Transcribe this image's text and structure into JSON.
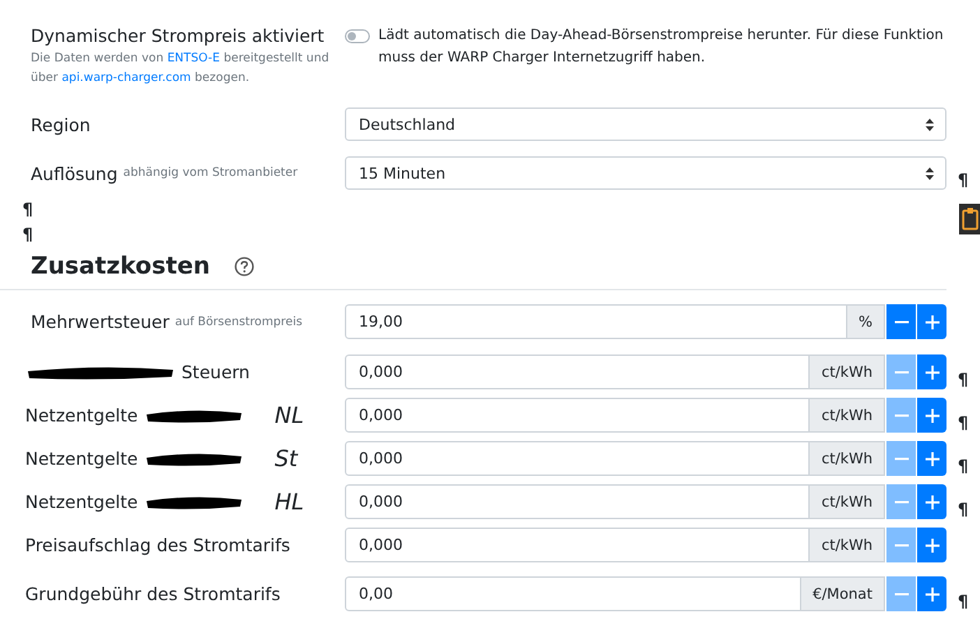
{
  "dynamic_price": {
    "title": "Dynamischer Strompreis aktiviert",
    "description": [
      {
        "text": "Die Daten werden von ",
        "link": false
      },
      {
        "text": "ENTSO-E",
        "link": true
      },
      {
        "text": " bereitgestellt und über ",
        "link": false
      },
      {
        "text": "api.warp-charger.com",
        "link": true
      },
      {
        "text": " bezogen.",
        "link": false
      }
    ],
    "switch_on": false,
    "switch_text": "Lädt automatisch die Day-Ahead-Börsenstrompreise herunter. Für diese Funktion muss der WARP Charger Internetzugriff haben."
  },
  "selects": [
    {
      "label": "Region",
      "value": "Deutschland"
    },
    {
      "label": "Auflösung",
      "hint": "abhängig vom Stromanbieter",
      "value": "15 Minuten",
      "pilcrow": "¶"
    }
  ],
  "loose_pilcrows": [
    "¶",
    "¶"
  ],
  "section": {
    "title": "Zusatzkosten"
  },
  "cost_rows": [
    {
      "label": "Mehrwertsteuer",
      "hint": "auf Börsenstrompreis",
      "redacted_before": false,
      "redacted_after": false,
      "value": "19,00",
      "unit": "%",
      "minus_disabled": false
    },
    {
      "label": "Steuern",
      "redacted_before": true,
      "redacted_after": false,
      "value": "0,000",
      "unit": "ct/kWh",
      "minus_disabled": true,
      "pilcrow": "¶"
    },
    {
      "label": "Netzentgelte",
      "redacted_before": false,
      "redacted_after": true,
      "annotation": "NL",
      "value": "0,000",
      "unit": "ct/kWh",
      "minus_disabled": true,
      "pilcrow": "¶"
    },
    {
      "label": "Netzentgelte",
      "redacted_before": false,
      "redacted_after": true,
      "annotation": "St",
      "value": "0,000",
      "unit": "ct/kWh",
      "minus_disabled": true,
      "pilcrow": "¶"
    },
    {
      "label": "Netzentgelte",
      "redacted_before": false,
      "redacted_after": true,
      "annotation": "HL",
      "value": "0,000",
      "unit": "ct/kWh",
      "minus_disabled": true,
      "pilcrow": "¶"
    },
    {
      "label": "Preisaufschlag des Stromtarifs",
      "redacted_before": false,
      "redacted_after": false,
      "value": "0,000",
      "unit": "ct/kWh",
      "minus_disabled": true
    },
    {
      "label": "Grundgebühr des Stromtarifs",
      "redacted_before": false,
      "redacted_after": false,
      "value": "0,00",
      "unit": "€/Monat",
      "minus_disabled": true,
      "pilcrow": "¶"
    }
  ]
}
